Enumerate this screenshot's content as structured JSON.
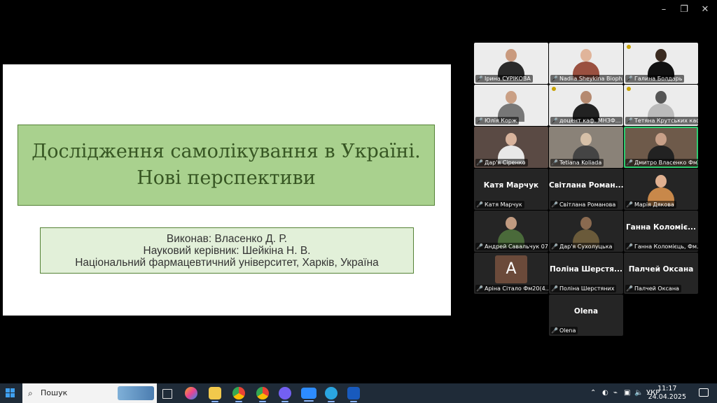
{
  "slide": {
    "title_line1": "Дослідження самолікування в Україні.",
    "title_line2": "Нові перспективи",
    "info_line1": "Виконав: Власенко Д. Р.",
    "info_line2": "Науковий керівник: Шейкіна Н. В.",
    "info_line3": "Національний фармацевтичний університет, Харків, Україна"
  },
  "gallery": {
    "tiles": [
      {
        "label": "Ірина СУРІКОВА"
      },
      {
        "label": "Nadiia Sheykina Bioph..."
      },
      {
        "label": "Галина Болдарь"
      },
      {
        "label": "Юлія Корж"
      },
      {
        "label": "доцент каф. МНЗФ..."
      },
      {
        "label": "Тетяна Крутських каф..."
      },
      {
        "label": "Дар'я Сіренко"
      },
      {
        "label": "Tetiana Koliada"
      },
      {
        "label": "Дмитро Власенко Фм24(..."
      },
      {
        "label": "Катя Марчук",
        "big": "Катя Марчук"
      },
      {
        "label": "Світлана Романова",
        "big": "Світлана Роман..."
      },
      {
        "label": "Марія Дякова"
      },
      {
        "label": "Андрей Савальчук 07..."
      },
      {
        "label": "Дар'я Сухолуцька"
      },
      {
        "label": "Ганна Коломієць, Фм...",
        "big": "Ганна Коломіє..."
      },
      {
        "label": "Аріна Сітало Фм20(4...",
        "avatar": "A"
      },
      {
        "label": "Поліна Шерстяних",
        "big": "Поліна Шерстя..."
      },
      {
        "label": "Палчей Оксана",
        "big": "Палчей Оксана"
      },
      {
        "label": "Olena",
        "big": "Olena"
      }
    ]
  },
  "taskbar": {
    "search_label": "Пошук",
    "lang": "УКР",
    "time": "11:17",
    "date": "24.04.2025"
  },
  "window_controls": {
    "minimize": "–",
    "restore": "❐",
    "close": "✕"
  }
}
